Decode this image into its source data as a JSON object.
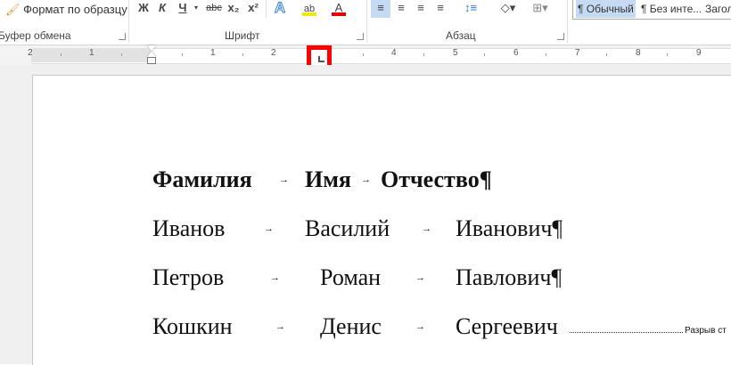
{
  "ribbon": {
    "clipboard": {
      "format_painter": "Формат по образцу",
      "group_label": "Буфер обмена"
    },
    "font": {
      "group_label": "Шрифт",
      "bold": "Ж",
      "italic": "К",
      "underline": "Ч",
      "strike": "abc",
      "subscript": "x₂",
      "superscript": "x²",
      "text_effects": "A",
      "highlight": "ab",
      "font_color": "A"
    },
    "paragraph": {
      "group_label": "Абзац"
    },
    "styles": {
      "items": [
        "¶ Обычный",
        "¶ Без инте...",
        "Загол"
      ],
      "selected": "¶ Обычный"
    }
  },
  "ruler": {
    "labels": [
      "2",
      "1",
      "1",
      "2",
      "4",
      "5",
      "6",
      "7",
      "8",
      "9"
    ]
  },
  "document": {
    "rows": [
      {
        "c1": "Фамилия",
        "c2": "Имя",
        "c3": "Отчество¶",
        "bold": true
      },
      {
        "c1": "Иванов",
        "c2": "Василий",
        "c3": "Иванович¶"
      },
      {
        "c1": "Петров",
        "c2": "Роман",
        "c3": "Павлович¶"
      },
      {
        "c1": "Кошкин",
        "c2": "Денис",
        "c3": "Сергеевич"
      }
    ],
    "tab_arrow": "→",
    "page_break": "Разрыв ст"
  },
  "colors": {
    "highlight": "#f0e800",
    "font_color": "#e00000",
    "marker": "#ff0000",
    "selected_bg": "#c5daf3"
  }
}
